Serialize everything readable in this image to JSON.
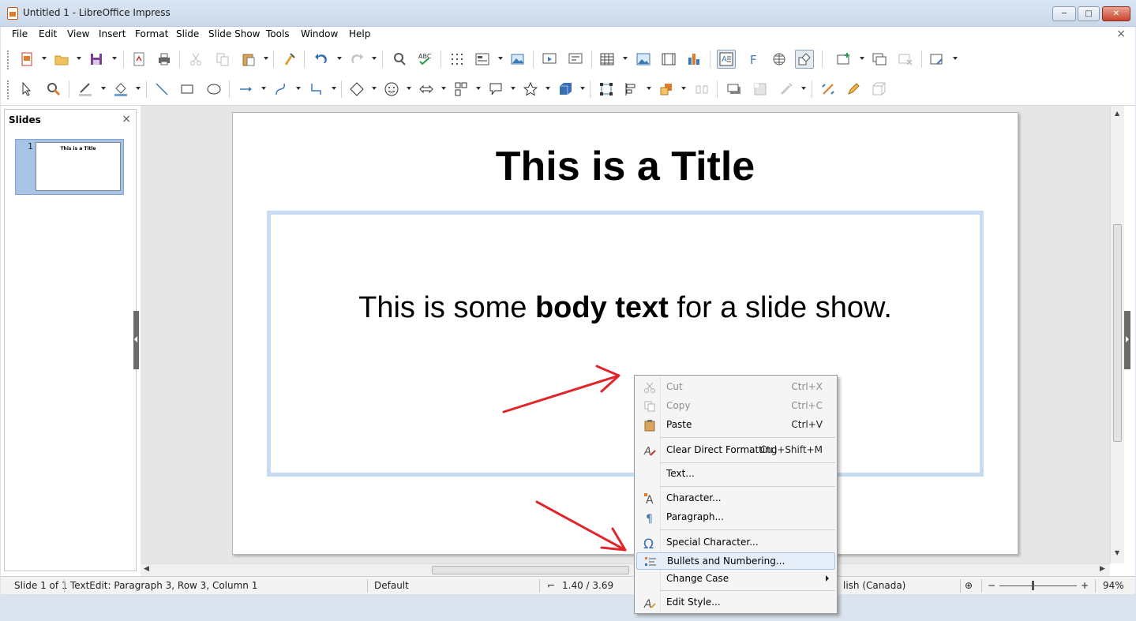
{
  "window": {
    "title": "Untitled 1 - LibreOffice Impress",
    "min_label": "─",
    "max_label": "□",
    "close_label": "✕"
  },
  "menubar": {
    "items": [
      "File",
      "Edit",
      "View",
      "Insert",
      "Format",
      "Slide",
      "Slide Show",
      "Tools",
      "Window",
      "Help"
    ],
    "doc_close": "×"
  },
  "slides_pane": {
    "title": "Slides",
    "close": "×",
    "thumbnails": [
      {
        "number": "1",
        "title": "This is a Title"
      }
    ]
  },
  "slide": {
    "title": "This is a Title",
    "body_before": "This is some ",
    "body_bold": "body text",
    "body_after": " for a slide show."
  },
  "context_menu": {
    "items": [
      {
        "label": "Cut",
        "shortcut": "Ctrl+X",
        "icon": "scissors-icon",
        "disabled": true
      },
      {
        "label": "Copy",
        "shortcut": "Ctrl+C",
        "icon": "copy-icon",
        "disabled": true
      },
      {
        "label": "Paste",
        "shortcut": "Ctrl+V",
        "icon": "clipboard-icon",
        "disabled": false
      },
      {
        "label": "Clear Direct Formatting",
        "shortcut": "Ctrl+Shift+M",
        "icon": "clear-formatting-icon",
        "disabled": false
      },
      {
        "label": "Text...",
        "shortcut": "",
        "icon": "",
        "disabled": false
      },
      {
        "label": "Character...",
        "shortcut": "",
        "icon": "character-icon",
        "disabled": false
      },
      {
        "label": "Paragraph...",
        "shortcut": "",
        "icon": "paragraph-icon",
        "disabled": false
      },
      {
        "label": "Special Character...",
        "shortcut": "",
        "icon": "omega-icon",
        "disabled": false
      },
      {
        "label": "Bullets and Numbering...",
        "shortcut": "",
        "icon": "bullet-list-icon",
        "disabled": false,
        "highlighted": true
      },
      {
        "label": "Change Case",
        "shortcut": "",
        "icon": "",
        "disabled": false,
        "submenu": true
      },
      {
        "label": "Edit Style...",
        "shortcut": "",
        "icon": "edit-style-icon",
        "disabled": false
      }
    ]
  },
  "statusbar": {
    "slide": "Slide 1 of 1",
    "edit_mode": "TextEdit: Paragraph 3, Row 3, Column 1",
    "master": "Default",
    "position": "1.40 / 3.69",
    "language": "lish (Canada)",
    "zoom_minus": "−",
    "zoom_plus": "+",
    "zoom_value": "94%"
  },
  "colors": {
    "annotation_arrow": "#e0262b",
    "body_box_border": "#c7dcf2",
    "menu_highlight": "#e5eef9"
  }
}
